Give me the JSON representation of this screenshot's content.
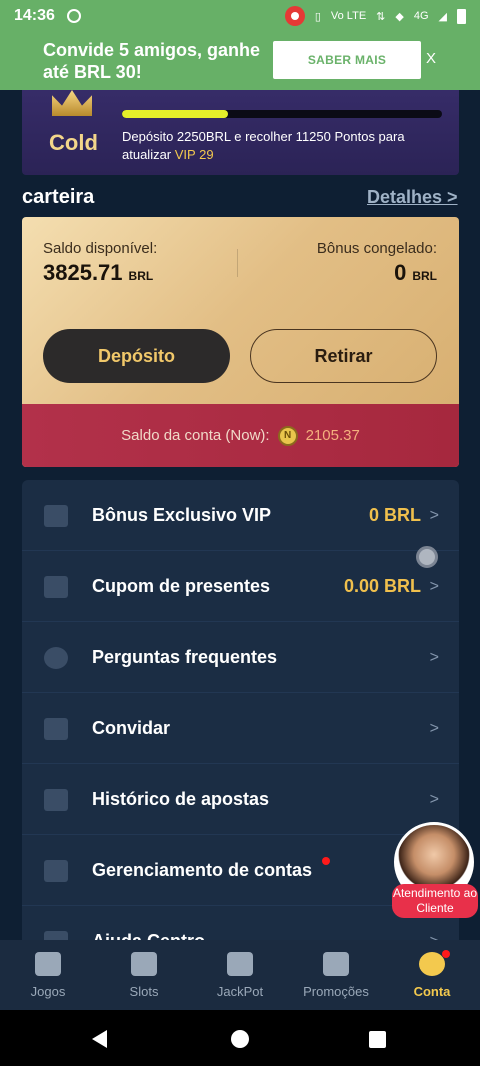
{
  "status_bar": {
    "time": "14:36",
    "network": "4G"
  },
  "promo": {
    "text": "Convide 5 amigos, ganhe até BRL 30!",
    "button_label": "SABER MAIS",
    "close_label": "X"
  },
  "vip": {
    "tier": "Cold",
    "progress": 0.33,
    "desc_prefix": "Depósito 2250BRL e recolher 11250 Pontos para atualizar",
    "next_level": "VIP 29"
  },
  "wallet": {
    "title": "carteira",
    "details_link": "Detalhes >",
    "available_label": "Saldo disponível:",
    "available_value": "3825.71",
    "available_currency": "BRL",
    "frozen_label": "Bônus congelado:",
    "frozen_value": "0",
    "frozen_currency": "BRL",
    "deposit_button": "Depósito",
    "withdraw_button": "Retirar",
    "account_label": "Saldo da conta (Now):",
    "account_coin": "N",
    "account_value": "2105.37"
  },
  "menu": {
    "items": [
      {
        "label": "Bônus Exclusivo VIP",
        "value": "0 BRL",
        "icon": "gift-icon"
      },
      {
        "label": "Cupom de presentes",
        "value": "0.00 BRL",
        "icon": "ticket-icon"
      },
      {
        "label": "Perguntas frequentes",
        "value": "",
        "icon": "question-icon"
      },
      {
        "label": "Convidar",
        "value": "",
        "icon": "users-icon"
      },
      {
        "label": "Histórico de apostas",
        "value": "",
        "icon": "edit-document-icon"
      },
      {
        "label": "Gerenciamento de contas",
        "value": "",
        "icon": "user-list-icon"
      },
      {
        "label": "Ajuda Centro",
        "value": "",
        "icon": "help-center-icon"
      }
    ],
    "chevron": ">"
  },
  "support": {
    "label": "Atendimento ao Cliente"
  },
  "bottom_nav": {
    "items": [
      {
        "label": "Jogos",
        "icon": "home-icon"
      },
      {
        "label": "Slots",
        "icon": "gamepad-icon"
      },
      {
        "label": "JackPot",
        "icon": "trophy-icon"
      },
      {
        "label": "Promoções",
        "icon": "flag-icon"
      },
      {
        "label": "Conta",
        "icon": "account-smile-icon",
        "active": true
      }
    ]
  },
  "colors": {
    "accent": "#f3c94e",
    "background": "#0e1f33",
    "promo_green": "#67b067",
    "account_bar": "#b2314a"
  }
}
